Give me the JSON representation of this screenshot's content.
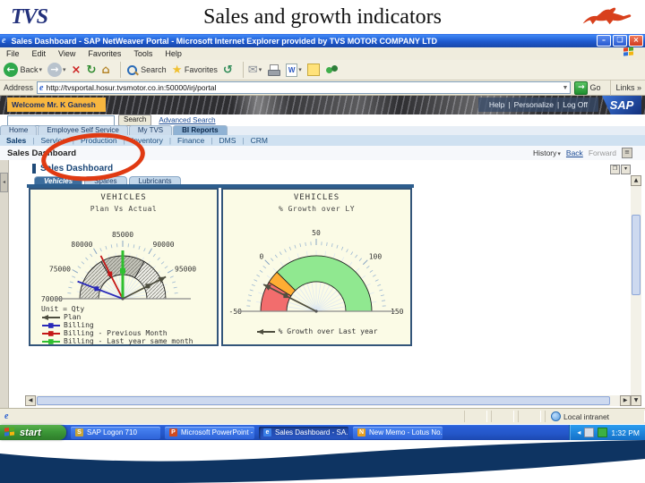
{
  "slide": {
    "logo_text": "TVS",
    "title": "Sales and growth indicators",
    "tvs_blue": "#23317c",
    "horse_red": "#d8401c",
    "wave_navy": "#0e3462"
  },
  "browser": {
    "window_title": "Sales Dashboard - SAP NetWeaver Portal - Microsoft Internet Explorer provided by TVS MOTOR COMPANY LTD",
    "menus": [
      "File",
      "Edit",
      "View",
      "Favorites",
      "Tools",
      "Help"
    ],
    "toolbar_buttons": [
      {
        "name": "back",
        "label": "Back"
      },
      {
        "name": "forward",
        "label": ""
      },
      {
        "name": "stop",
        "label": ""
      },
      {
        "name": "refresh",
        "label": ""
      },
      {
        "name": "home",
        "label": ""
      },
      {
        "name": "search",
        "label": "Search"
      },
      {
        "name": "favorites",
        "label": "Favorites"
      },
      {
        "name": "history",
        "label": ""
      },
      {
        "name": "mail",
        "label": ""
      },
      {
        "name": "print",
        "label": ""
      },
      {
        "name": "edit-word",
        "label": ""
      },
      {
        "name": "note",
        "label": ""
      },
      {
        "name": "messenger",
        "label": ""
      }
    ],
    "address_label": "Address",
    "address_value": "http://tvsportal.hosur.tvsmotor.co.in:50000/irj/portal",
    "go_label": "Go",
    "links_label": "Links",
    "status_zone": "Local intranet"
  },
  "portal": {
    "welcome": "Welcome Mr. K Ganesh",
    "masthead_links": [
      "Help",
      "Personalize",
      "Log Off"
    ],
    "sap_logo": "SAP",
    "search_button": "Search",
    "advanced_search_link": "Advanced Search",
    "top_tabs": [
      "Home",
      "Employee Self Service",
      "My TVS",
      "BI Reports"
    ],
    "active_top_tab": "BI Reports",
    "subnav_items": [
      "Sales",
      "Service",
      "Production",
      "Inventory",
      "Finance",
      "DMS",
      "CRM"
    ],
    "active_subnav": "Sales",
    "page_title": "Sales Dashboard",
    "history_label": "History",
    "back_label": "Back",
    "forward_label": "Forward",
    "panel_title": "Sales Dashboard",
    "panel_tabs": [
      "Vehicles",
      "Spares",
      "Lubricants"
    ],
    "active_panel_tab": "Vehicles"
  },
  "chart_data": [
    {
      "type": "gauge",
      "title": "VEHICLES",
      "subtitle": "Plan Vs Actual",
      "unit_label": "Unit = Qty",
      "min": 70000,
      "max": 100000,
      "tick_labels": [
        "70000",
        "75000",
        "80000",
        "85000",
        "90000",
        "95000"
      ],
      "tick_values": [
        70000,
        75000,
        80000,
        85000,
        90000,
        95000
      ],
      "bands": [
        {
          "from": 70000,
          "to": 80000,
          "color": "#e0e0d8",
          "texture": "hatch"
        },
        {
          "from": 80000,
          "to": 90000,
          "color": "#c4c4ba",
          "texture": "hatch"
        },
        {
          "from": 90000,
          "to": 100000,
          "color": "#eeeee8",
          "texture": "hatch"
        }
      ],
      "needles": [
        {
          "name": "Plan",
          "value": 95500,
          "color": "#4f4f40",
          "marker": "arrow"
        },
        {
          "name": "Billing",
          "value": 73500,
          "color": "#2929b8",
          "marker": "square"
        },
        {
          "name": "Billing - Previous Month",
          "value": 80500,
          "color": "#c41818",
          "marker": "square"
        },
        {
          "name": "Billing - Last year same month",
          "value": 85000,
          "color": "#2fbf2f",
          "marker": "square",
          "thick": true
        }
      ],
      "legend_position": "bottom-left"
    },
    {
      "type": "gauge",
      "title": "VEHICLES",
      "subtitle": "% Growth over LY",
      "min": -50,
      "max": 150,
      "tick_labels": [
        "-50",
        "0",
        "50",
        "100",
        "150"
      ],
      "tick_values": [
        -50,
        0,
        50,
        100,
        150
      ],
      "bands": [
        {
          "from": -50,
          "to": -15,
          "color": "#f26d6d"
        },
        {
          "from": -15,
          "to": 0,
          "color": "#ffad33"
        },
        {
          "from": 0,
          "to": 150,
          "color": "#90e890"
        }
      ],
      "needles": [
        {
          "name": "% Growth over Last year",
          "value": -20,
          "color": "#4f4f40",
          "marker": "arrow"
        }
      ],
      "legend_position": "bottom-center"
    }
  ],
  "taskbar": {
    "start_label": "start",
    "items": [
      {
        "label": "SAP Logon 710",
        "app": "sap",
        "active": false
      },
      {
        "label": "Microsoft PowerPoint -",
        "app": "powerpoint",
        "active": false
      },
      {
        "label": "Sales Dashboard - SA...",
        "app": "ie",
        "active": true
      },
      {
        "label": "New Memo - Lotus No...",
        "app": "lotus",
        "active": false
      }
    ],
    "clock": "1:32 PM"
  }
}
